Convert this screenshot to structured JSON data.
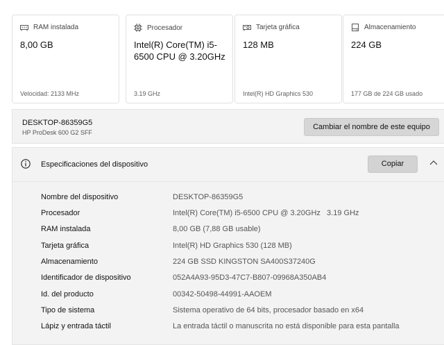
{
  "cards": [
    {
      "icon": "ram-icon",
      "title": "RAM instalada",
      "value": "8,00 GB",
      "sub": "Velocidad: 2133 MHz"
    },
    {
      "icon": "processor-icon",
      "title": "Procesador",
      "value": "Intel(R) Core(TM) i5-6500 CPU @ 3.20GHz",
      "sub": "3.19 GHz"
    },
    {
      "icon": "graphics-card-icon",
      "title": "Tarjeta gráfica",
      "value": "128 MB",
      "sub": "Intel(R) HD Graphics 530"
    },
    {
      "icon": "storage-icon",
      "title": "Almacenamiento",
      "value": "224 GB",
      "sub": "177 GB de 224 GB usado"
    }
  ],
  "device": {
    "name": "DESKTOP-86359G5",
    "model": "HP ProDesk 600 G2 SFF",
    "rename_label": "Cambiar el nombre de este equipo"
  },
  "specs": {
    "title": "Especificaciones del dispositivo",
    "copy_label": "Copiar",
    "rows": [
      {
        "key": "Nombre del dispositivo",
        "value": "DESKTOP-86359G5"
      },
      {
        "key": "Procesador",
        "value": "Intel(R) Core(TM) i5-6500 CPU @ 3.20GHz   3.19 GHz"
      },
      {
        "key": "RAM instalada",
        "value": "8,00 GB (7,88 GB usable)"
      },
      {
        "key": "Tarjeta gráfica",
        "value": "Intel(R) HD Graphics 530 (128 MB)"
      },
      {
        "key": "Almacenamiento",
        "value": "224 GB SSD KINGSTON SA400S37240G"
      },
      {
        "key": "Identificador de dispositivo",
        "value": "052A4A93-95D3-47C7-B807-09968A350AB4"
      },
      {
        "key": "Id. del producto",
        "value": "00342-50498-44991-AAOEM"
      },
      {
        "key": "Tipo de sistema",
        "value": "Sistema operativo de 64 bits, procesador basado en x64"
      },
      {
        "key": "Lápiz y entrada táctil",
        "value": "La entrada táctil o manuscrita no está disponible para esta pantalla"
      }
    ]
  }
}
